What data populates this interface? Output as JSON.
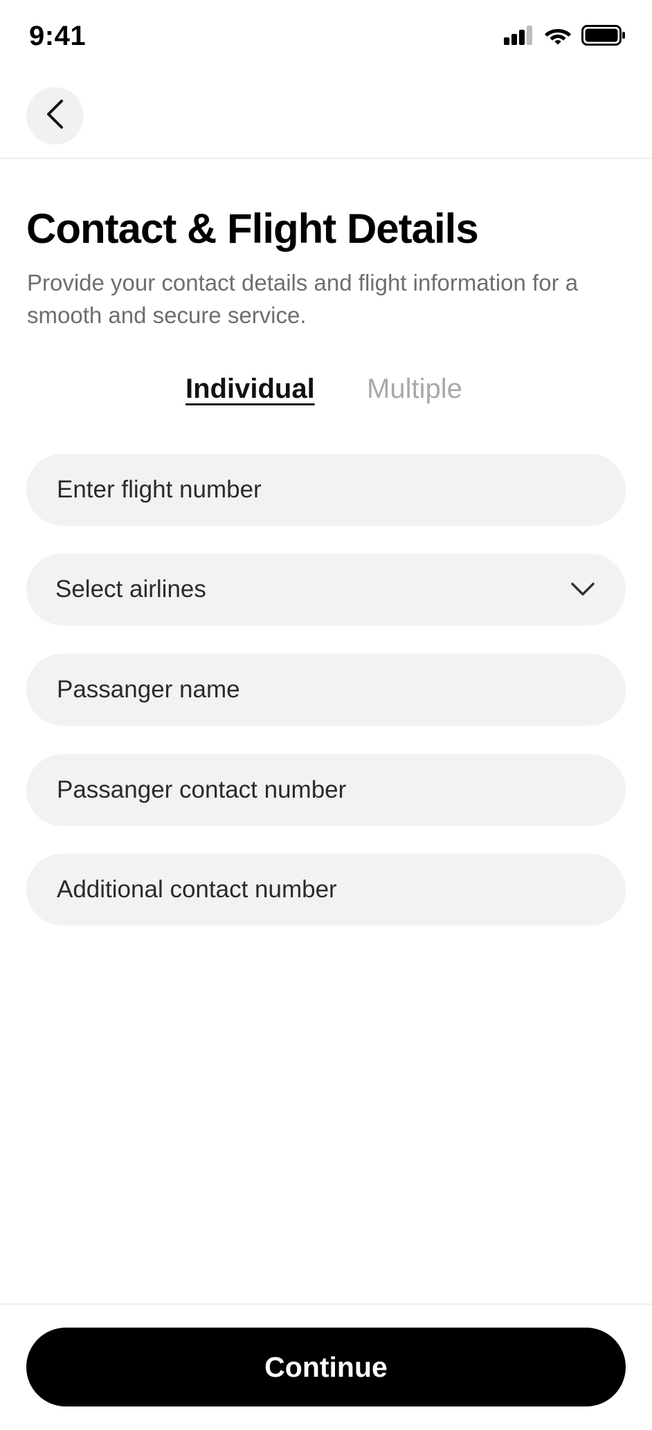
{
  "status_bar": {
    "time": "9:41",
    "icons": [
      "cellular-signal-icon",
      "wifi-icon",
      "battery-icon"
    ]
  },
  "header": {
    "back_icon": "chevron-left-icon"
  },
  "title": "Contact & Flight Details",
  "subtitle": "Provide your contact details and flight information for a smooth and secure service.",
  "tabs": [
    {
      "label": "Individual",
      "active": true
    },
    {
      "label": "Multiple",
      "active": false
    }
  ],
  "form": {
    "flight_number": {
      "value": "",
      "placeholder": "Enter flight number"
    },
    "airlines": {
      "selected": "Select airlines",
      "icon": "chevron-down-icon"
    },
    "passenger_name": {
      "value": "",
      "placeholder": "Passanger name"
    },
    "passenger_contact": {
      "value": "",
      "placeholder": "Passanger contact number"
    },
    "additional_contact": {
      "value": "",
      "placeholder": "Additional contact number"
    }
  },
  "footer": {
    "continue_label": "Continue"
  },
  "colors": {
    "primary": "#000000",
    "field_background": "#f2f2f2",
    "subtitle_text": "#6e6e6e",
    "inactive_tab": "#a9a9a9"
  }
}
